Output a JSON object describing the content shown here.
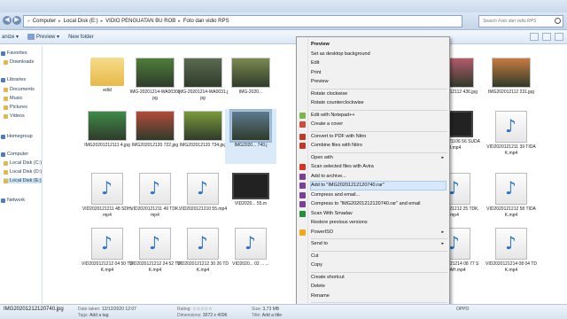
{
  "window": {
    "address_parts": [
      "Computer",
      "Local Disk (E:)",
      "VIDIO PENGUATAN BU ROB",
      "Foto dan vidio RPS"
    ],
    "search_placeholder": "Search Foto dan vidio RPS"
  },
  "toolbar": {
    "organize": "anize ▾",
    "preview": "Preview ▾",
    "new_folder": "New folder"
  },
  "sidebar": [
    {
      "label": "Favorites",
      "kind": "head"
    },
    {
      "label": "Downloads",
      "kind": "item"
    },
    {
      "label": "Libraries",
      "kind": "head"
    },
    {
      "label": "Documents",
      "kind": "item"
    },
    {
      "label": "Music",
      "kind": "item"
    },
    {
      "label": "Pictures",
      "kind": "item"
    },
    {
      "label": "Videos",
      "kind": "item"
    },
    {
      "label": "Homegroup",
      "kind": "head"
    },
    {
      "label": "Computer",
      "kind": "head"
    },
    {
      "label": "Local Disk (C:)",
      "kind": "item"
    },
    {
      "label": "Local Disk (D:)",
      "kind": "item"
    },
    {
      "label": "Local Disk (E:)",
      "kind": "item",
      "selected": true
    },
    {
      "label": "Network",
      "kind": "head"
    }
  ],
  "files": [
    {
      "name": "edid",
      "type": "folder"
    },
    {
      "name": "IMG-20201214-WA0030.jpg",
      "type": "photo",
      "color": "#4e7e3a"
    },
    {
      "name": "IMG-20201214-WA0031.jpg",
      "type": "photo",
      "color": "#5b6b52"
    },
    {
      "name": "IMG-2020...",
      "type": "photo",
      "color": "#7a8a50"
    },
    {
      "name": "",
      "type": "hidden"
    },
    {
      "name": "",
      "type": "hidden"
    },
    {
      "name": "",
      "type": "hidden"
    },
    {
      "name": "",
      "type": "hidden"
    },
    {
      "name": "IMG202012112 436.jpg",
      "type": "photo",
      "color": "#b45a6b"
    },
    {
      "name": "IMG202012112 231.jpg",
      "type": "photo",
      "color": "#c77a40"
    },
    {
      "name": "IMG20201212111 4.jpg",
      "type": "photo",
      "color": "#3f8a4a"
    },
    {
      "name": "IMG202012120 722.jpg",
      "type": "photo",
      "color": "#b44a3a"
    },
    {
      "name": "IMG202012120 734.jpg",
      "type": "photo",
      "color": "#7a9a3a"
    },
    {
      "name": "IMG2020... 740.j",
      "type": "photo",
      "color": "#5d7a8f",
      "selected": true
    },
    {
      "name": "",
      "type": "hidden"
    },
    {
      "name": "",
      "type": "hidden"
    },
    {
      "name": "",
      "type": "hidden"
    },
    {
      "name": "IMG-20201214-W A0034.jpg",
      "type": "photo",
      "color": "#3f7a40"
    },
    {
      "name": "VID2020121106 56 SUDAH.mp4",
      "type": "video"
    },
    {
      "name": "VID2020121211 39 TIDAK.mp4",
      "type": "audio"
    },
    {
      "name": "VID2020121211 48 SDH.mp4",
      "type": "audio"
    },
    {
      "name": "VID2020121211 49 TDK.mp4",
      "type": "audio"
    },
    {
      "name": "VID2020121210 55.mp4",
      "type": "audio"
    },
    {
      "name": "VID2020... 55.m",
      "type": "video"
    },
    {
      "name": "",
      "type": "hidden"
    },
    {
      "name": "",
      "type": "hidden"
    },
    {
      "name": "",
      "type": "hidden"
    },
    {
      "name": "",
      "type": "hidden"
    },
    {
      "name": "VID2020121212 25 TDK.mp4",
      "type": "audio"
    },
    {
      "name": "VID2020121212 58 TIDAK.mp4",
      "type": "audio"
    },
    {
      "name": "VID2020121212 04 50 TDK.mp4",
      "type": "audio"
    },
    {
      "name": "VID2020121212 24 52 TDK.mp4",
      "type": "audio"
    },
    {
      "name": "VID2020121212 30 26 TDK.mp4",
      "type": "audio"
    },
    {
      "name": "VID2020... 02 ... ...",
      "type": "audio"
    },
    {
      "name": "",
      "type": "hidden"
    },
    {
      "name": "",
      "type": "hidden"
    },
    {
      "name": "",
      "type": "hidden"
    },
    {
      "name": "VID2020121210 953 41 TDK.mp4",
      "type": "audio"
    },
    {
      "name": "VID2020121214 08 77 SUDAH.mp4",
      "type": "audio"
    },
    {
      "name": "VID2020121214 08 04 TDK.mp4",
      "type": "audio"
    }
  ],
  "context_menu": [
    {
      "label": "Preview",
      "bold": true
    },
    {
      "label": "Set as desktop background"
    },
    {
      "label": "Edit"
    },
    {
      "label": "Print"
    },
    {
      "label": "Preview"
    },
    {
      "sep": true
    },
    {
      "label": "Rotate clockwise"
    },
    {
      "label": "Rotate counterclockwise"
    },
    {
      "sep": true
    },
    {
      "label": "Edit with Notepad++",
      "icon": "#7ab648"
    },
    {
      "label": "Create a cover",
      "icon": "#d24b3a"
    },
    {
      "sep": true
    },
    {
      "label": "Convert to PDF with Nitro",
      "icon": "#c0392b"
    },
    {
      "label": "Combine files with Nitro",
      "icon": "#c0392b"
    },
    {
      "sep": true
    },
    {
      "label": "Open with",
      "arrow": true
    },
    {
      "label": "Scan selected files with Avira",
      "icon": "#d9331f"
    },
    {
      "label": "Add to archive...",
      "icon": "#7b3f98"
    },
    {
      "label": "Add to \"IMG20201212120740.rar\"",
      "icon": "#7b3f98",
      "highlight": true
    },
    {
      "label": "Compress and email...",
      "icon": "#7b3f98"
    },
    {
      "label": "Compress to \"IMG20201212120740.rar\" and email",
      "icon": "#7b3f98"
    },
    {
      "label": "Scan With Smadav",
      "icon": "#1f8f3a"
    },
    {
      "label": "Restore previous versions"
    },
    {
      "label": "PowerISO",
      "icon": "#f2a71b",
      "arrow": true
    },
    {
      "sep": true
    },
    {
      "label": "Send to",
      "arrow": true
    },
    {
      "sep": true
    },
    {
      "label": "Cut"
    },
    {
      "label": "Copy"
    },
    {
      "sep": true
    },
    {
      "label": "Create shortcut"
    },
    {
      "label": "Delete"
    },
    {
      "label": "Rename"
    },
    {
      "sep": true
    },
    {
      "label": "Properties"
    }
  ],
  "details": {
    "filename": "IMG20201212120740.jpg",
    "date_taken_key": "Date taken:",
    "date_taken": "12/12/2020 12:07",
    "rating_key": "Rating:",
    "rating": "☆☆☆☆☆",
    "dimensions_key": "Dimensions:",
    "dimensions": "3072 x 4096",
    "size_key": "Size:",
    "size": "3,73 MB",
    "title_key": "Title:",
    "title": "Add a title",
    "camera": "OPPO",
    "tags_key": "Tags:",
    "tags": "Add a tag"
  }
}
